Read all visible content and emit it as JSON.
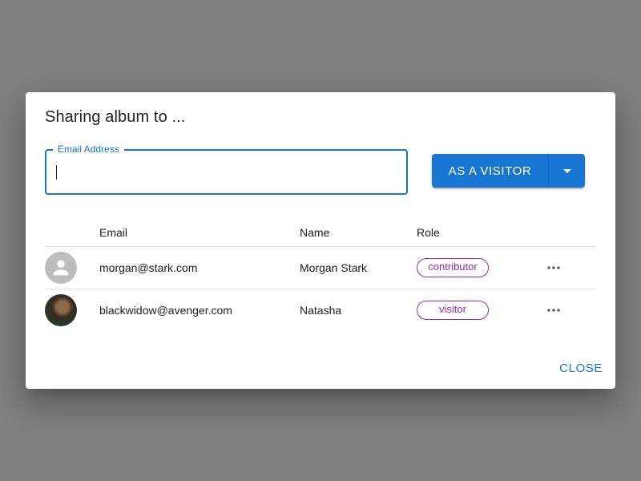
{
  "dialog": {
    "title": "Sharing album to ...",
    "email_field": {
      "label": "Email Address",
      "value": ""
    },
    "share_button": {
      "label": "AS A VISITOR",
      "dropdown_icon": "arrow-drop-down-icon"
    },
    "table": {
      "headers": {
        "email": "Email",
        "name": "Name",
        "role": "Role"
      },
      "rows": [
        {
          "avatar": "default-person-icon",
          "email": "morgan@stark.com",
          "name": "Morgan Stark",
          "role": "contributor",
          "more_icon": "more-horiz-icon"
        },
        {
          "avatar": "photo",
          "email": "blackwidow@avenger.com",
          "name": "Natasha",
          "role": "visitor",
          "more_icon": "more-horiz-icon"
        }
      ]
    },
    "close_label": "CLOSE"
  },
  "colors": {
    "backdrop": "#808080",
    "primary": "#1976d2",
    "chip": "#9c27b0"
  }
}
